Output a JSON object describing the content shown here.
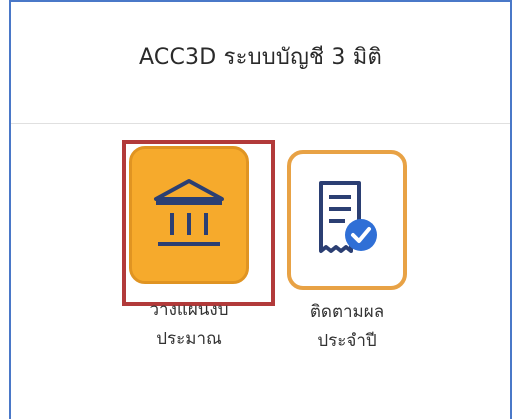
{
  "header": {
    "title": "ACC3D ระบบบัญชี 3 มิติ"
  },
  "menu": {
    "items": [
      {
        "icon": "bank-icon",
        "line1": "วางแผนงบ",
        "line2": "ประมาณ",
        "selected": true,
        "accent": "#f6aa2c"
      },
      {
        "icon": "receipt-check-icon",
        "line1": "ติดตามผล",
        "line2": "ประจำปี",
        "selected": false,
        "accent": "#e8a245"
      }
    ]
  },
  "colors": {
    "frame": "#4a78c8",
    "selection": "#b23a3a",
    "icon_blue": "#2f6fd6",
    "icon_navy": "#2b3f73"
  }
}
